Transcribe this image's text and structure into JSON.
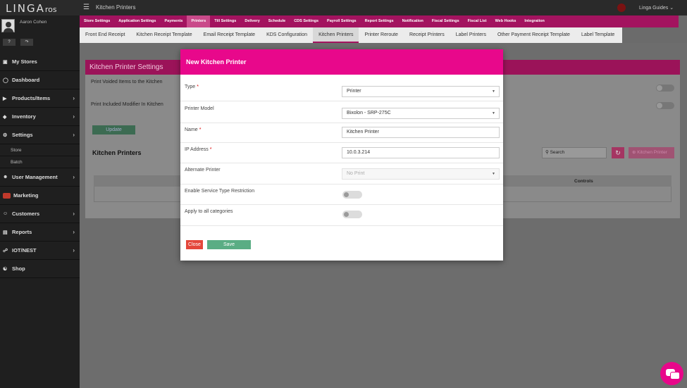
{
  "app": {
    "logo_main": "LINGA",
    "logo_sub": "ros",
    "page_title": "Kitchen Printers",
    "guides_label": "Linga Guides"
  },
  "user": {
    "name": "Aaron Cohen"
  },
  "sidebar": {
    "items": [
      {
        "label": "My Stores",
        "icon": "store-icon",
        "chevron": false
      },
      {
        "label": "Dashboard",
        "icon": "dashboard-icon",
        "chevron": false
      },
      {
        "label": "Products/Items",
        "icon": "products-icon",
        "chevron": true
      },
      {
        "label": "Inventory",
        "icon": "inventory-icon",
        "chevron": true
      },
      {
        "label": "Settings",
        "icon": "settings-icon",
        "chevron": true
      }
    ],
    "sub_items": [
      "Store",
      "Batch"
    ],
    "items2": [
      {
        "label": "User Management",
        "icon": "users-icon",
        "chevron": true
      },
      {
        "label": "Marketing",
        "icon": "marketing-icon",
        "chevron": false
      },
      {
        "label": "Customers",
        "icon": "customers-icon",
        "chevron": true
      },
      {
        "label": "Reports",
        "icon": "reports-icon",
        "chevron": true
      },
      {
        "label": "IOT/NEST",
        "icon": "iot-icon",
        "chevron": true
      },
      {
        "label": "Shop",
        "icon": "cart-icon",
        "chevron": false
      }
    ]
  },
  "tabs_primary": [
    "Store Settings",
    "Application Settings",
    "Payments",
    "Printers",
    "Till Settings",
    "Delivery",
    "Schedule",
    "CDS Settings",
    "Payroll Settings",
    "Report Settings",
    "Notification",
    "Fiscal Settings",
    "Fiscal List",
    "Web Hooks",
    "Integration"
  ],
  "tabs_primary_active": "Printers",
  "tabs_secondary": [
    "Front End Receipt",
    "Kitchen Receipt Template",
    "Email Receipt Template",
    "KDS Configuration",
    "Kitchen Printers",
    "Printer Reroute",
    "Receipt Printers",
    "Label Printers",
    "Other Payment Receipt Template",
    "Label Template"
  ],
  "tabs_secondary_active": "Kitchen Printers",
  "background": {
    "panel_title": "Kitchen Printer Settings",
    "setting1": "Print Voided Items to the Kitchen",
    "setting2": "Print Included Modifier In Kitchen",
    "update_button": "Update",
    "section_title": "Kitchen Printers",
    "search_label": "Search",
    "add_button": "Kitchen Printer",
    "col_controls": "Controls"
  },
  "modal": {
    "title": "New Kitchen Printer",
    "type_label": "Type",
    "type_value": "Printer",
    "model_label": "Printer Model",
    "model_value": "Bixolon - SRP-275C",
    "name_label": "Name",
    "name_value": "Kitchen Printer",
    "ip_label": "IP Address",
    "ip_value": "10.0.3.214",
    "alt_label": "Alternate Printer",
    "alt_value": "No Print",
    "service_label": "Enable Service Type Restriction",
    "apply_label": "Apply to all categories",
    "close_button": "Close",
    "save_button": "Save"
  },
  "colors": {
    "brand_pink": "#e8088b",
    "tab_bar": "#a3135f",
    "save_green": "#5aad84",
    "close_red": "#e4473b"
  }
}
